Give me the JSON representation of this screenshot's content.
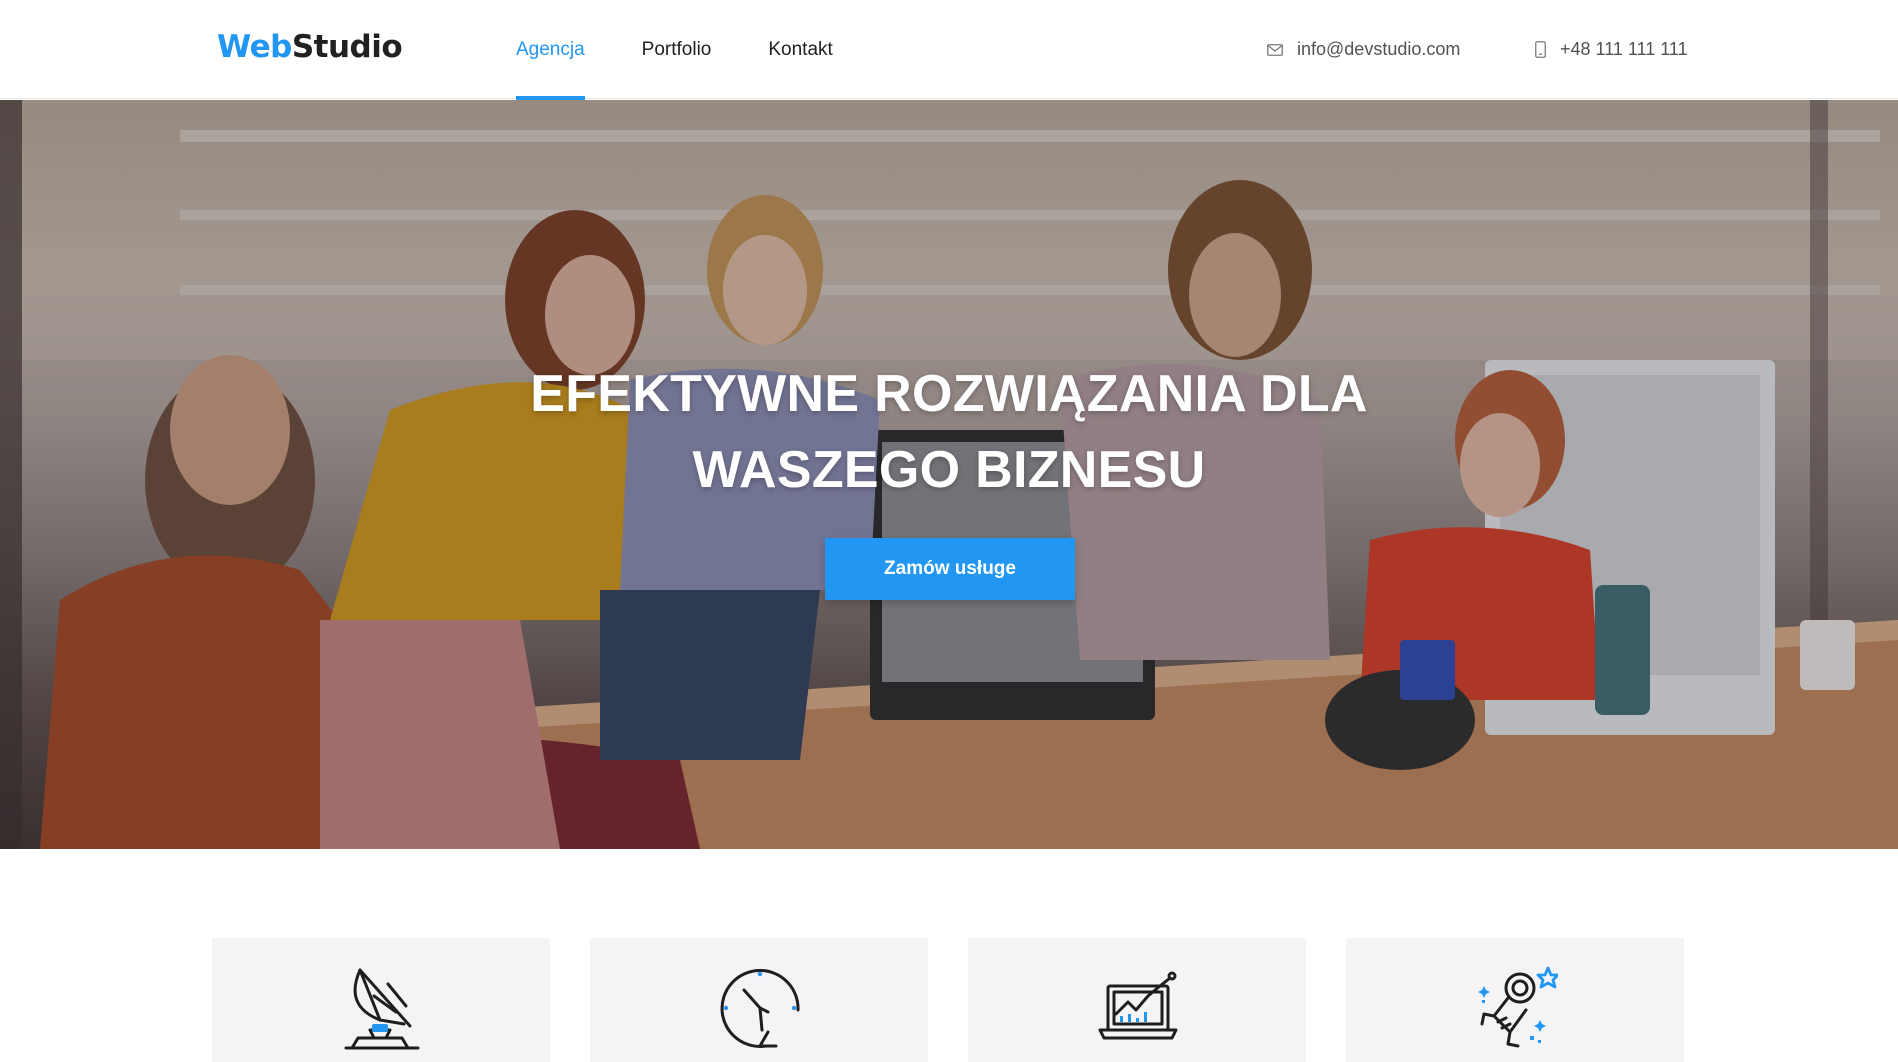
{
  "header": {
    "logo": {
      "part1": "Web",
      "part2": "Studio"
    },
    "nav": [
      {
        "label": "Agencja",
        "active": true
      },
      {
        "label": "Portfolio",
        "active": false
      },
      {
        "label": "Kontakt",
        "active": false
      }
    ],
    "email": {
      "icon": "mail-icon",
      "text": "info@devstudio.com"
    },
    "phone": {
      "icon": "phone-icon",
      "text": "+48 111 111 111"
    }
  },
  "hero": {
    "title_line1": "EFEKTYWNE ROZWIĄZANIA DLA",
    "title_line2": "WASZEGO BIZNESU",
    "cta_label": "Zamów usługe",
    "background": "photo-team-in-office"
  },
  "features": [
    {
      "icon": "satellite-dish-icon"
    },
    {
      "icon": "clock-icon"
    },
    {
      "icon": "laptop-chart-icon"
    },
    {
      "icon": "astronaut-icon"
    }
  ],
  "colors": {
    "accent": "#2196f3",
    "text": "#212121",
    "card_bg": "#f4f4f7"
  }
}
